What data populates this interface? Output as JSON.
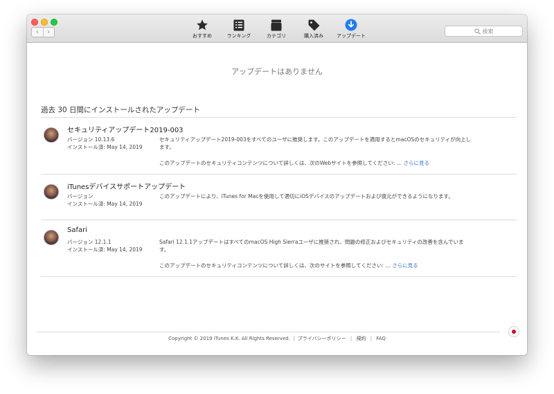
{
  "toolbar": {
    "items": [
      {
        "label": "おすすめ",
        "icon": "star-icon"
      },
      {
        "label": "ランキング",
        "icon": "list-icon"
      },
      {
        "label": "カテゴリ",
        "icon": "box-icon"
      },
      {
        "label": "購入済み",
        "icon": "tag-icon"
      },
      {
        "label": "アップデート",
        "icon": "download-icon"
      }
    ],
    "active_color": "#1f7cf2",
    "search_placeholder": "検索"
  },
  "main": {
    "no_updates": "アップデートはありません",
    "section_title": "過去 30 日間にインストールされたアップデート",
    "updates": [
      {
        "title": "セキュリティアップデート2019-003",
        "version": "バージョン 10.13.6",
        "installed": "インストール済: May 14, 2019",
        "desc_line1": "セキュリティアップデート2019-003をすべてのユーザに推奨します。このアップデートを適用するとmacOSのセキュリティが向上し",
        "desc_line2": "ます。",
        "desc_link_text": "このアップデートのセキュリティコンテンツについて詳しくは、次のWebサイトを参照してください: …",
        "more": "さらに見る"
      },
      {
        "title": "iTunesデバイスサポートアップデート",
        "version": "バージョン",
        "installed": "インストール済: May 14, 2019",
        "desc_line1": "このアップデートにより、iTunes for Macを使用して適切にiOSデバイスのアップデートおよび復元ができるようになります。"
      },
      {
        "title": "Safari",
        "version": "バージョン 12.1.1",
        "installed": "インストール済: May 14, 2019",
        "desc_line1": "Safari 12.1.1アップデートはすべてのmacOS High Sierraユーザに推奨され、問題の修正およびセキュリティの改善を含んでいま",
        "desc_line2": "す。",
        "desc_link_text": "このアップデートのセキュリティコンテンツについて詳しくは、次のサイトを参照してください: …",
        "more": "さらに見る"
      }
    ]
  },
  "footer": {
    "copyright": "Copyright © 2019 iTunes K.K. All Rights Reserved.",
    "privacy": "プライバシーポリシー",
    "terms": "規約",
    "faq": "FAQ",
    "separator": "|"
  },
  "flag": {
    "name": "japan-flag-icon",
    "color": "#c8102e"
  }
}
